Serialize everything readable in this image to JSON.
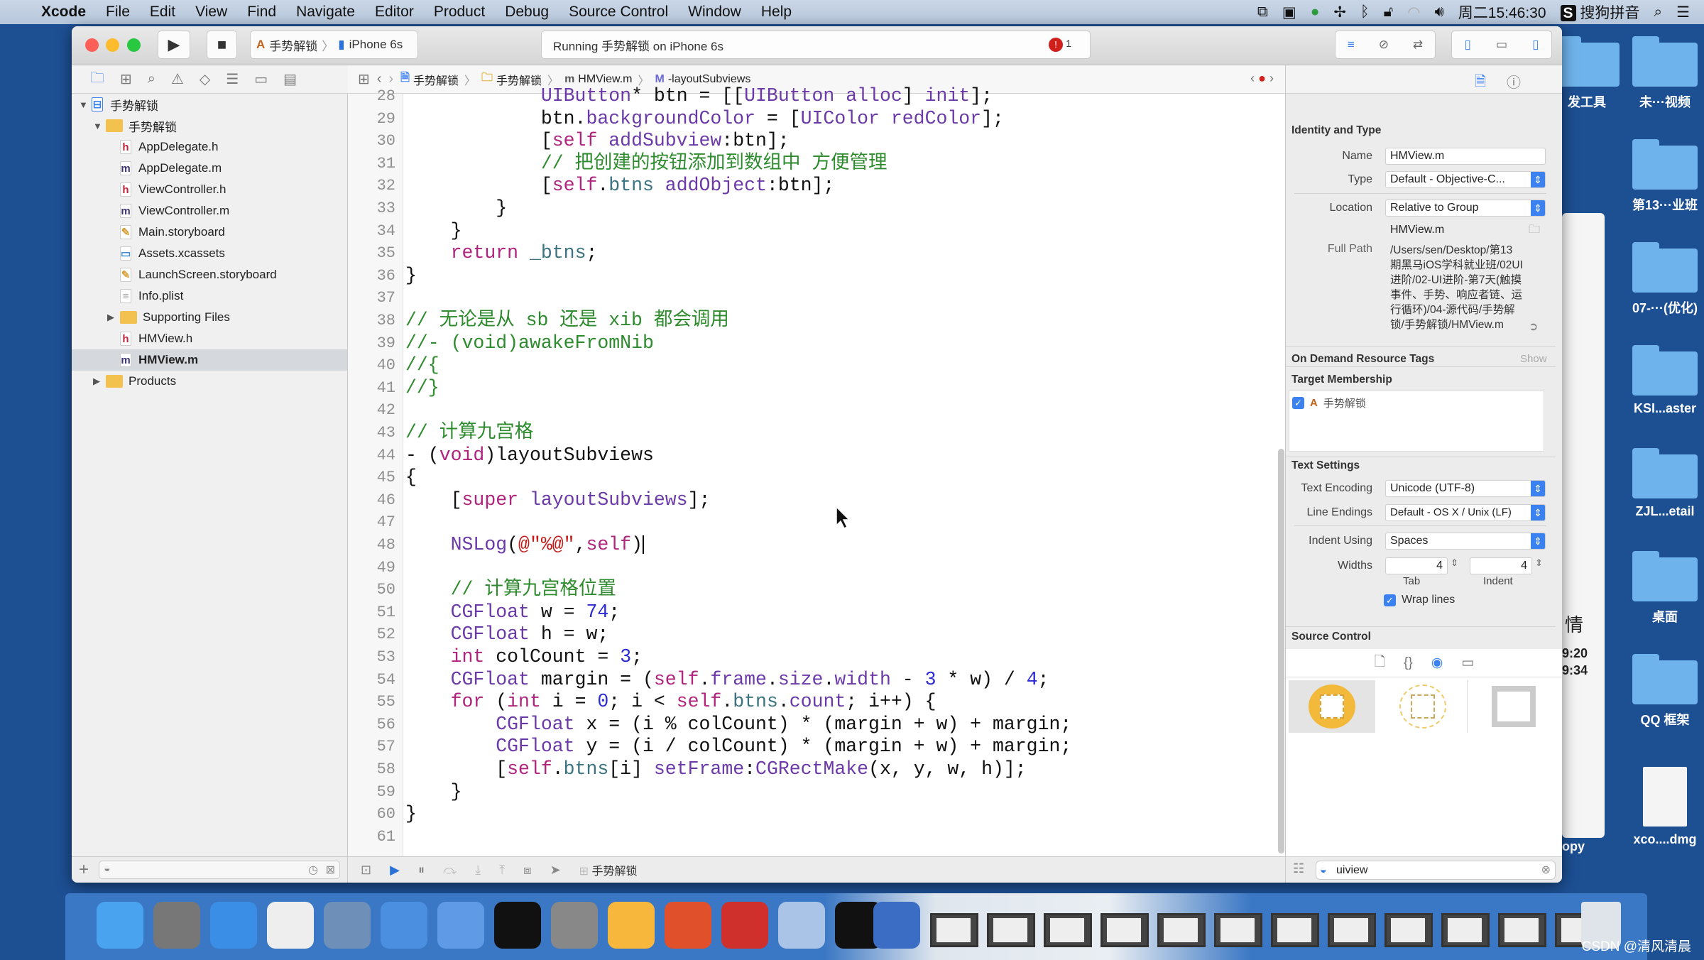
{
  "menubar": {
    "app": "Xcode",
    "items": [
      "File",
      "Edit",
      "View",
      "Find",
      "Navigate",
      "Editor",
      "Product",
      "Debug",
      "Source Control",
      "Window",
      "Help"
    ],
    "clock": "周二15:46:30",
    "input_method": "搜狗拼音"
  },
  "desktop": {
    "icons": [
      "发工具",
      "未···视频",
      "第13···业班",
      "07-···(优化)",
      "KSI...aster",
      "ZJL...etail",
      "桌面",
      "QQ 框架",
      "xco....dmg"
    ],
    "background_window": {
      "title_char": "情",
      "times": [
        "9:20",
        "9:34"
      ],
      "label": "opy"
    }
  },
  "toolbar": {
    "scheme": "手势解锁",
    "device": "iPhone 6s",
    "activity": "Running 手势解锁 on iPhone 6s",
    "error_count": "1"
  },
  "jumpbar": {
    "crumbs": [
      "手势解锁",
      "手势解锁",
      "HMView.m",
      "-layoutSubviews"
    ]
  },
  "navigator": {
    "items": [
      {
        "label": "手势解锁",
        "kind": "project",
        "depth": 0,
        "disclosure": "open"
      },
      {
        "label": "手势解锁",
        "kind": "folder",
        "depth": 1,
        "disclosure": "open"
      },
      {
        "label": "AppDelegate.h",
        "kind": "h",
        "depth": 2
      },
      {
        "label": "AppDelegate.m",
        "kind": "m",
        "depth": 2
      },
      {
        "label": "ViewController.h",
        "kind": "h",
        "depth": 2
      },
      {
        "label": "ViewController.m",
        "kind": "m",
        "depth": 2
      },
      {
        "label": "Main.storyboard",
        "kind": "storyboard",
        "depth": 2
      },
      {
        "label": "Assets.xcassets",
        "kind": "assets",
        "depth": 2
      },
      {
        "label": "LaunchScreen.storyboard",
        "kind": "storyboard",
        "depth": 2
      },
      {
        "label": "Info.plist",
        "kind": "plist",
        "depth": 2
      },
      {
        "label": "Supporting Files",
        "kind": "folder",
        "depth": 2,
        "disclosure": "closed"
      },
      {
        "label": "HMView.h",
        "kind": "h",
        "depth": 2
      },
      {
        "label": "HMView.m",
        "kind": "m",
        "depth": 2,
        "selected": true
      },
      {
        "label": "Products",
        "kind": "folder",
        "depth": 1,
        "disclosure": "closed"
      }
    ]
  },
  "editor": {
    "first_line": 28,
    "lines": [
      [
        [
          "            ",
          "p"
        ],
        [
          "UIButton",
          "t"
        ],
        [
          "* btn = [[",
          "p"
        ],
        [
          "UIButton",
          "t"
        ],
        [
          " ",
          "p"
        ],
        [
          "alloc",
          "m"
        ],
        [
          "] ",
          "p"
        ],
        [
          "init",
          "m"
        ],
        [
          "];",
          "p"
        ]
      ],
      [
        [
          "            btn.",
          "p"
        ],
        [
          "backgroundColor",
          "m"
        ],
        [
          " = [",
          "p"
        ],
        [
          "UIColor",
          "t"
        ],
        [
          " ",
          "p"
        ],
        [
          "redColor",
          "m"
        ],
        [
          "];",
          "p"
        ]
      ],
      [
        [
          "            [",
          "p"
        ],
        [
          "self",
          "k"
        ],
        [
          " ",
          "p"
        ],
        [
          "addSubview",
          "m"
        ],
        [
          ":btn];",
          "p"
        ]
      ],
      [
        [
          "            // 把创建的按钮添加到数组中 方便管理",
          "c"
        ]
      ],
      [
        [
          "            [",
          "p"
        ],
        [
          "self",
          "k"
        ],
        [
          ".",
          "p"
        ],
        [
          "btns",
          "v"
        ],
        [
          " ",
          "p"
        ],
        [
          "addObject",
          "m"
        ],
        [
          ":btn];",
          "p"
        ]
      ],
      [
        [
          "        }",
          "p"
        ]
      ],
      [
        [
          "    }",
          "p"
        ]
      ],
      [
        [
          "    ",
          "p"
        ],
        [
          "return",
          "k"
        ],
        [
          " ",
          "p"
        ],
        [
          "_btns",
          "v"
        ],
        [
          ";",
          "p"
        ]
      ],
      [
        [
          "}",
          "p"
        ]
      ],
      [],
      [
        [
          "// 无论是从 sb 还是 xib 都会调用",
          "c"
        ]
      ],
      [
        [
          "//- (void)awakeFromNib",
          "c"
        ]
      ],
      [
        [
          "//{",
          "c"
        ]
      ],
      [
        [
          "//}",
          "c"
        ]
      ],
      [],
      [
        [
          "// 计算九宫格",
          "c"
        ]
      ],
      [
        [
          "- (",
          "p"
        ],
        [
          "void",
          "k"
        ],
        [
          ")layoutSubviews",
          "p"
        ]
      ],
      [
        [
          "{",
          "p"
        ]
      ],
      [
        [
          "    [",
          "p"
        ],
        [
          "super",
          "k"
        ],
        [
          " ",
          "p"
        ],
        [
          "layoutSubviews",
          "m"
        ],
        [
          "];",
          "p"
        ]
      ],
      [],
      [
        [
          "    ",
          "p"
        ],
        [
          "NSLog",
          "m"
        ],
        [
          "(",
          "p"
        ],
        [
          "@\"%@\"",
          "s"
        ],
        [
          ",",
          "p"
        ],
        [
          "self",
          "k"
        ],
        [
          ")",
          "p"
        ]
      ],
      [],
      [
        [
          "    // 计算九宫格位置",
          "c"
        ]
      ],
      [
        [
          "    ",
          "p"
        ],
        [
          "CGFloat",
          "t"
        ],
        [
          " w = ",
          "p"
        ],
        [
          "74",
          "n"
        ],
        [
          ";",
          "p"
        ]
      ],
      [
        [
          "    ",
          "p"
        ],
        [
          "CGFloat",
          "t"
        ],
        [
          " h = w;",
          "p"
        ]
      ],
      [
        [
          "    ",
          "p"
        ],
        [
          "int",
          "k"
        ],
        [
          " colCount = ",
          "p"
        ],
        [
          "3",
          "n"
        ],
        [
          ";",
          "p"
        ]
      ],
      [
        [
          "    ",
          "p"
        ],
        [
          "CGFloat",
          "t"
        ],
        [
          " margin = (",
          "p"
        ],
        [
          "self",
          "k"
        ],
        [
          ".",
          "p"
        ],
        [
          "frame",
          "m"
        ],
        [
          ".",
          "p"
        ],
        [
          "size",
          "m"
        ],
        [
          ".",
          "p"
        ],
        [
          "width",
          "m"
        ],
        [
          " - ",
          "p"
        ],
        [
          "3",
          "n"
        ],
        [
          " * w) / ",
          "p"
        ],
        [
          "4",
          "n"
        ],
        [
          ";",
          "p"
        ]
      ],
      [
        [
          "    ",
          "p"
        ],
        [
          "for",
          "k"
        ],
        [
          " (",
          "p"
        ],
        [
          "int",
          "k"
        ],
        [
          " i = ",
          "p"
        ],
        [
          "0",
          "n"
        ],
        [
          "; i < ",
          "p"
        ],
        [
          "self",
          "k"
        ],
        [
          ".",
          "p"
        ],
        [
          "btns",
          "v"
        ],
        [
          ".",
          "p"
        ],
        [
          "count",
          "m"
        ],
        [
          "; i++) {",
          "p"
        ]
      ],
      [
        [
          "        ",
          "p"
        ],
        [
          "CGFloat",
          "t"
        ],
        [
          " x = (i % colCount) * (margin + w) + margin;",
          "p"
        ]
      ],
      [
        [
          "        ",
          "p"
        ],
        [
          "CGFloat",
          "t"
        ],
        [
          " y = (i / colCount) * (margin + w) + margin;",
          "p"
        ]
      ],
      [
        [
          "        [",
          "p"
        ],
        [
          "self",
          "k"
        ],
        [
          ".",
          "p"
        ],
        [
          "btns",
          "v"
        ],
        [
          "[i] ",
          "p"
        ],
        [
          "setFrame",
          "m"
        ],
        [
          ":",
          "p"
        ],
        [
          "CGRectMake",
          "m"
        ],
        [
          "(x, y, w, h)];",
          "p"
        ]
      ],
      [
        [
          "    }",
          "p"
        ]
      ],
      [
        [
          "}",
          "p"
        ]
      ],
      []
    ],
    "caret_line": 48
  },
  "debugbar": {
    "target": "手势解锁"
  },
  "inspector": {
    "identity": {
      "title": "Identity and Type",
      "name_label": "Name",
      "name": "HMView.m",
      "type_label": "Type",
      "type": "Default - Objective-C...",
      "location_label": "Location",
      "location": "Relative to Group",
      "filename": "HMView.m",
      "fullpath_label": "Full Path",
      "fullpath_lines": [
        "/Users/sen/Desktop/第13",
        "期黑马iOS学科就业班/02UI",
        "进阶/02-UI进阶-第7天(触摸",
        "事件、手势、响应者链、运",
        "行循环)/04-源代码/手势解",
        "锁/手势解锁/HMView.m"
      ]
    },
    "odr": {
      "title": "On Demand Resource Tags",
      "action": "Show"
    },
    "target": {
      "title": "Target Membership",
      "item": "手势解锁",
      "checked": true
    },
    "text": {
      "title": "Text Settings",
      "encoding_label": "Text Encoding",
      "encoding": "Unicode (UTF-8)",
      "endings_label": "Line Endings",
      "endings": "Default - OS X / Unix (LF)",
      "indent_label": "Indent Using",
      "indent": "Spaces",
      "widths_label": "Widths",
      "tab": "4",
      "indent_width": "4",
      "tab_label": "Tab",
      "indent_width_label": "Indent",
      "wrap_label": "Wrap lines",
      "wrap": true
    },
    "source_control": {
      "title": "Source Control"
    },
    "library_filter": "uiview"
  },
  "dock": {
    "apps": [
      "finder",
      "launchpad",
      "safari",
      "mouse",
      "video-editor",
      "xcode",
      "simulator",
      "terminal",
      "system-preferences",
      "sketch",
      "powerpoint",
      "teamviewer",
      "preview",
      "console",
      "quicktime"
    ]
  },
  "watermark": "CSDN @清风清晨",
  "colors": {
    "accent": "#3b82f0",
    "desktop": "#1d4f93",
    "error": "#d0201b"
  }
}
